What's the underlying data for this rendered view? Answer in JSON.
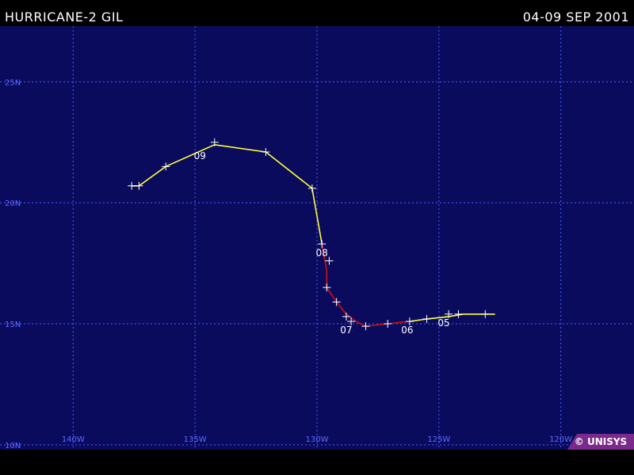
{
  "header": {
    "storm_title": "HURRICANE-2 GIL",
    "date_range": "04-09 SEP 2001"
  },
  "credit": "© UNISYS",
  "map": {
    "background_color": "#0b0b5e",
    "grid_color": "#4a5cff",
    "label_color": "#5a6cff",
    "lon_range": [
      -143,
      -117
    ],
    "lat_range": [
      9.8,
      27.3
    ],
    "longitudes": [
      {
        "value": -140,
        "label": "140W"
      },
      {
        "value": -135,
        "label": "135W"
      },
      {
        "value": -130,
        "label": "130W"
      },
      {
        "value": -125,
        "label": "125W"
      },
      {
        "value": -120,
        "label": "120W"
      }
    ],
    "latitudes": [
      {
        "value": 25,
        "label": "25N"
      },
      {
        "value": 20,
        "label": "20N"
      },
      {
        "value": 15,
        "label": "15N"
      },
      {
        "value": 10,
        "label": "10N"
      }
    ]
  },
  "track": {
    "colors": {
      "storm": "#ffff33",
      "hurricane": "#cc1111",
      "marker": "#ffffff"
    },
    "segments": [
      {
        "category": "storm",
        "points": [
          [
            -122.7,
            15.4
          ],
          [
            -124.0,
            15.4
          ],
          [
            -124.6,
            15.3
          ],
          [
            -125.5,
            15.2
          ],
          [
            -126.2,
            15.1
          ]
        ]
      },
      {
        "category": "hurricane",
        "points": [
          [
            -126.2,
            15.1
          ],
          [
            -127.1,
            15.0
          ],
          [
            -128.0,
            14.9
          ],
          [
            -128.4,
            15.1
          ],
          [
            -128.8,
            15.4
          ],
          [
            -129.2,
            15.9
          ],
          [
            -129.6,
            16.5
          ],
          [
            -129.6,
            17.2
          ],
          [
            -129.8,
            18.3
          ]
        ]
      },
      {
        "category": "storm",
        "points": [
          [
            -129.8,
            18.3
          ],
          [
            -130.2,
            20.6
          ],
          [
            -132.1,
            22.1
          ],
          [
            -134.2,
            22.4
          ],
          [
            -136.2,
            21.5
          ],
          [
            -137.3,
            20.7
          ],
          [
            -137.6,
            20.7
          ]
        ]
      }
    ],
    "markers": [
      [
        -123.1,
        15.4
      ],
      [
        -124.2,
        15.4
      ],
      [
        -124.6,
        15.4
      ],
      [
        -125.5,
        15.2
      ],
      [
        -126.2,
        15.1
      ],
      [
        -127.1,
        15.0
      ],
      [
        -128.0,
        14.9
      ],
      [
        -128.6,
        15.1
      ],
      [
        -128.8,
        15.3
      ],
      [
        -129.2,
        15.9
      ],
      [
        -129.6,
        16.5
      ],
      [
        -129.5,
        17.6
      ],
      [
        -129.8,
        18.3
      ],
      [
        -130.2,
        20.6
      ],
      [
        -132.1,
        22.1
      ],
      [
        -134.2,
        22.5
      ],
      [
        -136.2,
        21.5
      ],
      [
        -137.3,
        20.7
      ],
      [
        -137.6,
        20.7
      ]
    ],
    "day_labels": [
      {
        "label": "05",
        "lon": -124.8,
        "lat": 15.1
      },
      {
        "label": "06",
        "lon": -126.3,
        "lat": 14.8
      },
      {
        "label": "07",
        "lon": -128.8,
        "lat": 14.8
      },
      {
        "label": "08",
        "lon": -129.8,
        "lat": 18.0
      },
      {
        "label": "09",
        "lon": -134.8,
        "lat": 22.0
      }
    ]
  }
}
